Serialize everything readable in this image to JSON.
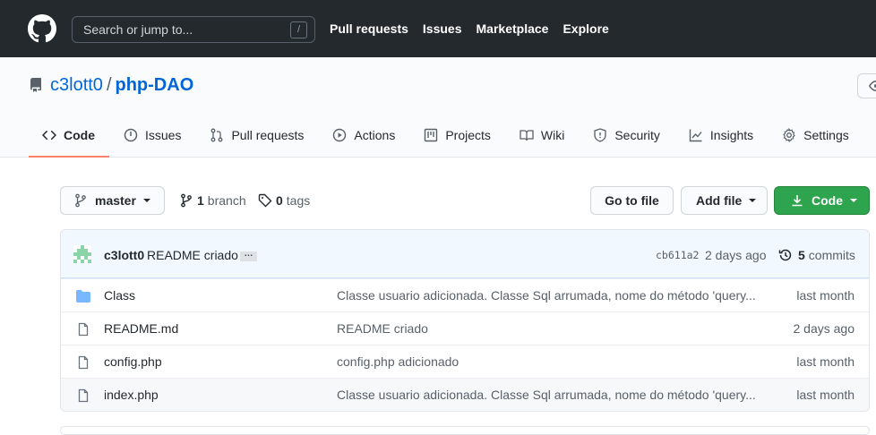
{
  "header": {
    "search_placeholder": "Search or jump to...",
    "search_key": "/",
    "nav": [
      "Pull requests",
      "Issues",
      "Marketplace",
      "Explore"
    ]
  },
  "repo": {
    "owner": "c3lott0",
    "separator": "/",
    "name": "php-DAO"
  },
  "tabs": [
    {
      "label": "Code",
      "icon": "code-icon",
      "selected": true
    },
    {
      "label": "Issues",
      "icon": "issue-icon"
    },
    {
      "label": "Pull requests",
      "icon": "pull-request-icon"
    },
    {
      "label": "Actions",
      "icon": "play-icon"
    },
    {
      "label": "Projects",
      "icon": "project-icon"
    },
    {
      "label": "Wiki",
      "icon": "book-icon"
    },
    {
      "label": "Security",
      "icon": "shield-icon"
    },
    {
      "label": "Insights",
      "icon": "graph-icon"
    },
    {
      "label": "Settings",
      "icon": "gear-icon"
    }
  ],
  "toolbar": {
    "branch_button": "master",
    "branch_count": "1",
    "branch_label": "branch",
    "tag_count": "0",
    "tag_label": "tags",
    "go_to_file": "Go to file",
    "add_file": "Add file",
    "code_button": "Code"
  },
  "commit": {
    "author": "c3lott0",
    "message": "README criado",
    "ellipsis": "…",
    "sha": "cb611a2",
    "date": "2 days ago",
    "count": "5",
    "count_label": "commits"
  },
  "files": [
    {
      "type": "folder",
      "name": "Class",
      "message": "Classe usuario adicionada. Classe Sql arrumada, nome do método 'query...",
      "age": "last month"
    },
    {
      "type": "file",
      "name": "README.md",
      "message": "README criado",
      "age": "2 days ago"
    },
    {
      "type": "file",
      "name": "config.php",
      "message": "config.php adicionado",
      "age": "last month"
    },
    {
      "type": "file",
      "name": "index.php",
      "message": "Classe usuario adicionada. Classe Sql arrumada, nome do método 'query...",
      "age": "last month"
    }
  ],
  "colors": {
    "header_bg": "#24292e",
    "link": "#0366d6",
    "tab_underline": "#f9826c",
    "code_button": "#2ea44f",
    "folder_icon": "#79b8ff"
  }
}
